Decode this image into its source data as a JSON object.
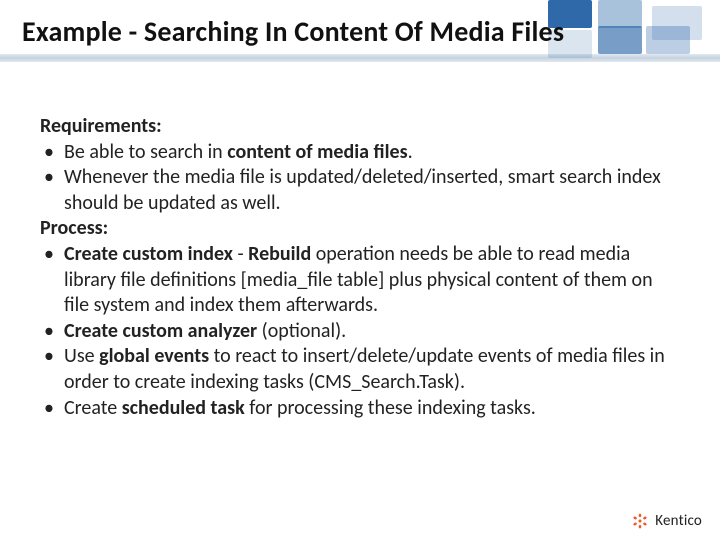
{
  "title": "Example - Searching In Content Of Media Files",
  "sections": {
    "req_label": "Requirements:",
    "req_items": [
      {
        "pre": "Be able to search in ",
        "bold": "content of media files",
        "post": "."
      },
      {
        "pre": "Whenever the media file is updated/deleted/inserted, smart search index should be updated as well.",
        "bold": "",
        "post": ""
      }
    ],
    "proc_label": "Process:",
    "proc_items": [
      {
        "b1": "Create custom index",
        "mid1": " - ",
        "b2": "Rebuild",
        "post": " operation needs be able to read media library file definitions [media_file table] plus physical content of them on file system and index them afterwards."
      },
      {
        "b1": "Create custom analyzer",
        "mid1": "",
        "b2": "",
        "post": " (optional)."
      },
      {
        "pre": "Use ",
        "b1": "global events",
        "post": " to react to insert/delete/update events of media files in order to create indexing tasks (CMS_Search.Task)."
      },
      {
        "pre": "Create ",
        "b1": "scheduled task",
        "post": " for processing these indexing tasks."
      }
    ]
  },
  "footer": {
    "brand": "Kentico"
  }
}
